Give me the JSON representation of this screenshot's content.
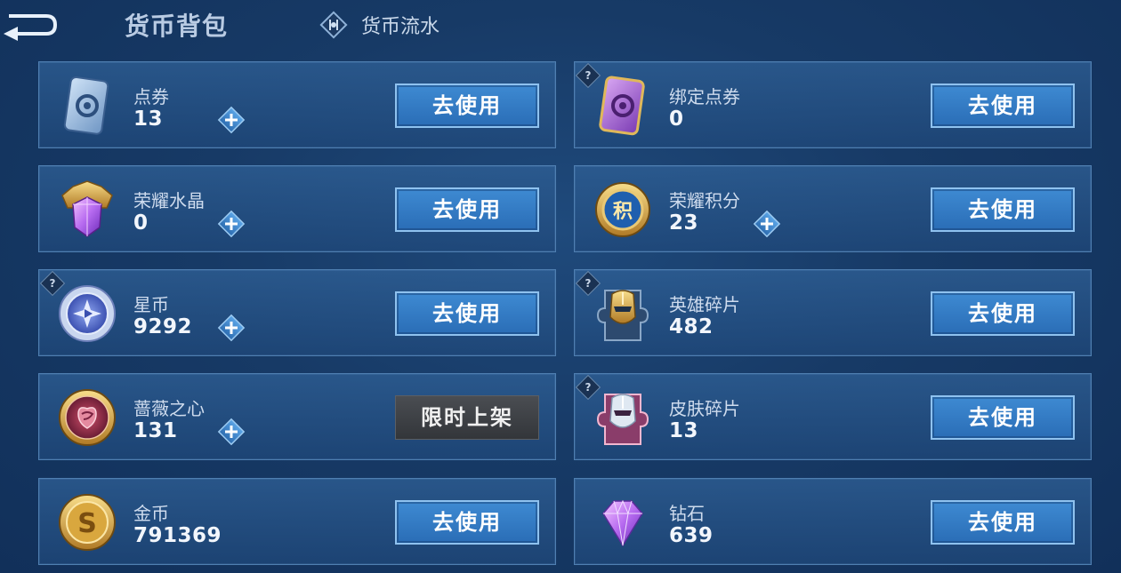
{
  "header": {
    "title": "货币背包",
    "flow_label": "货币流水"
  },
  "colors": {
    "accent": "#3e8ad2",
    "card_border": "#4f7fb1",
    "limited_button": "#3f4247"
  },
  "items": [
    {
      "name": "点券",
      "count": "13",
      "icon": "voucher-ticket-icon",
      "action": "去使用",
      "has_plus": true,
      "has_help": false
    },
    {
      "name": "绑定点券",
      "count": "0",
      "icon": "bound-voucher-icon",
      "action": "去使用",
      "has_plus": false,
      "has_help": true
    },
    {
      "name": "荣耀水晶",
      "count": "0",
      "icon": "glory-crystal-icon",
      "action": "去使用",
      "has_plus": true,
      "has_help": false
    },
    {
      "name": "荣耀积分",
      "count": "23",
      "icon": "glory-points-icon",
      "action": "去使用",
      "has_plus": true,
      "has_help": false
    },
    {
      "name": "星币",
      "count": "9292",
      "icon": "star-coin-icon",
      "action": "去使用",
      "has_plus": true,
      "has_help": true
    },
    {
      "name": "英雄碎片",
      "count": "482",
      "icon": "hero-fragment-icon",
      "action": "去使用",
      "has_plus": false,
      "has_help": true
    },
    {
      "name": "蔷薇之心",
      "count": "131",
      "icon": "rose-heart-icon",
      "action": "限时上架",
      "has_plus": true,
      "has_help": false
    },
    {
      "name": "皮肤碎片",
      "count": "13",
      "icon": "skin-fragment-icon",
      "action": "去使用",
      "has_plus": false,
      "has_help": true
    },
    {
      "name": "金币",
      "count": "791369",
      "icon": "gold-coin-icon",
      "action": "去使用",
      "has_plus": false,
      "has_help": false
    },
    {
      "name": "钻石",
      "count": "639",
      "icon": "diamond-icon",
      "action": "去使用",
      "has_plus": false,
      "has_help": false
    }
  ]
}
